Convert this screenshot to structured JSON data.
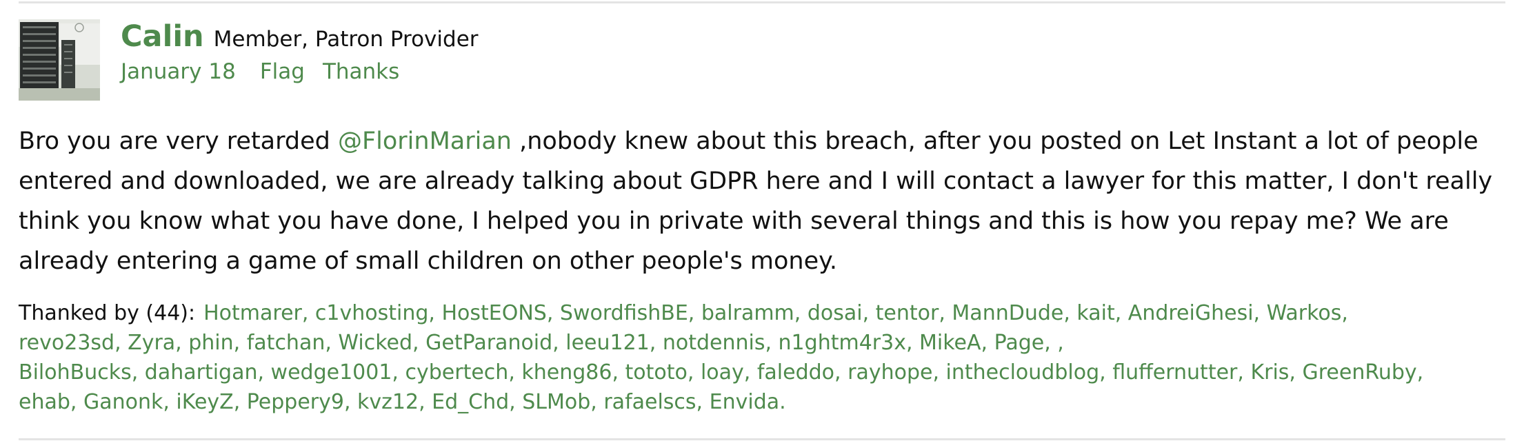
{
  "comment": {
    "author": {
      "name": "Calin",
      "role": "Member, Patron Provider"
    },
    "meta": {
      "date": "January 18",
      "flag_label": "Flag",
      "thanks_label": "Thanks"
    },
    "body": {
      "prefix": "Bro you are very retarded ",
      "mention": "@FlorinMarian",
      "rest": " ,nobody knew about this breach, after you posted on Let Instant a lot of people entered and downloaded, we are already talking about GDPR here and I will contact a lawyer for this matter, I don't really think you know what you have done, I helped you in private with several things and this is how you repay me? We are already entering a game of small children on other people's money."
    },
    "thanked_by": {
      "label": "Thanked by (44):",
      "lines": [
        "Hotmarer, c1vhosting, HostEONS, SwordfishBE, balramm, dosai, tentor, MannDude, kait, AndreiGhesi, Warkos,",
        "revo23sd, Zyra, phin, fatchan, Wicked, GetParanoid, leeu121, notdennis, n1ghtm4r3x, MikeA, Page, ,",
        "BilohBucks, dahartigan, wedge1001, cybertech, kheng86, tototo, loay, faleddo, rayhope, inthecloudblog, fluffernutter, Kris, GreenRuby,",
        "ehab, Ganonk, iKeyZ, Peppery9, kvz12, Ed_Chd, SLMob, rafaelscs, Envida."
      ]
    },
    "colors": {
      "link": "#4e8a4c",
      "text": "#111111",
      "divider": "#e4e4e4"
    }
  }
}
